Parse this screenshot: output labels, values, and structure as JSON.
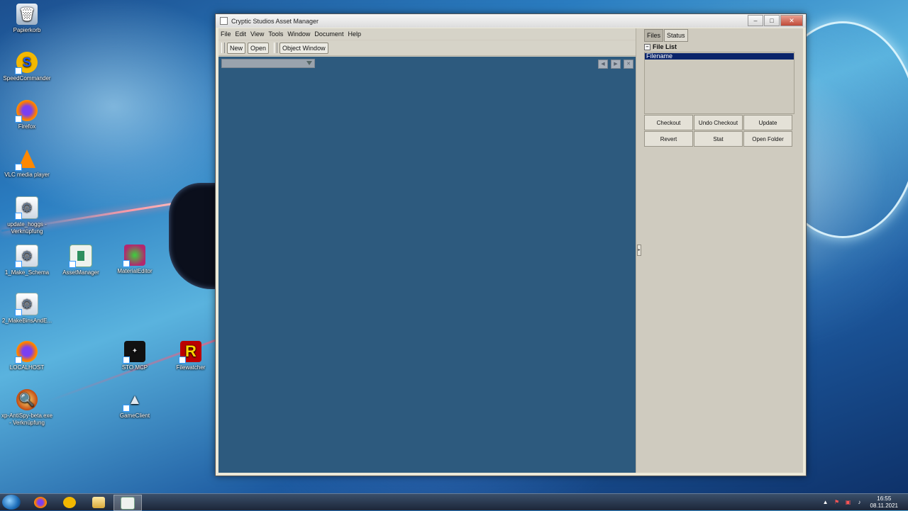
{
  "window": {
    "title": "Cryptic Studios Asset Manager",
    "controls": {
      "minimize": "–",
      "maximize": "□",
      "close": "✕"
    }
  },
  "menu": [
    "File",
    "Edit",
    "View",
    "Tools",
    "Window",
    "Document",
    "Help"
  ],
  "toolbar": {
    "new_label": "New",
    "open_label": "Open",
    "object_window_label": "Object Window"
  },
  "document": {
    "nav_prev": "◀",
    "nav_next": "▶",
    "nav_close": "✕"
  },
  "right_panel": {
    "tabs": [
      "Files",
      "Status"
    ],
    "file_list_title": "File List",
    "file_list_header": "Filename",
    "expander": "–",
    "actions": [
      "Checkout",
      "Undo Checkout",
      "Update",
      "Revert",
      "Stat",
      "Open Folder"
    ]
  },
  "desktop_icons": [
    {
      "label": "Papierkorb",
      "icon": "recycle-bin-icon"
    },
    {
      "label": "SpeedCommander",
      "icon": "speedcommander-icon"
    },
    {
      "label": "Firefox",
      "icon": "firefox-icon"
    },
    {
      "label": "VLC media player",
      "icon": "vlc-icon"
    },
    {
      "label": "update_hoggs - Verknüpfung",
      "icon": "gear-icon"
    },
    {
      "label": "1_Make_Schema",
      "icon": "gear-icon"
    },
    {
      "label": "AssetManager",
      "icon": "assetmanager-icon"
    },
    {
      "label": "MaterialEditor",
      "icon": "materialeditor-icon"
    },
    {
      "label": "2_MakeBinsAndE...",
      "icon": "gear-icon"
    },
    {
      "label": "LOCALHOST",
      "icon": "firefox-icon"
    },
    {
      "label": "STO MCP",
      "icon": "sto-icon"
    },
    {
      "label": "Filewatcher",
      "icon": "filewatcher-icon"
    },
    {
      "label": "xp-AntiSpy-beta.exe - Verknüpfung",
      "icon": "antispy-icon"
    },
    {
      "label": "GameClient",
      "icon": "gameclient-icon"
    }
  ],
  "taskbar": {
    "items": [
      "firefox-icon",
      "speedcommander-icon",
      "file-explorer-icon",
      "assetmanager-icon"
    ],
    "time": "16:55",
    "date": "08.11.2021"
  },
  "colors": {
    "document_bg": "#2d5a7e",
    "selection": "#0a246a",
    "panel_bg": "#cfcbbf"
  }
}
